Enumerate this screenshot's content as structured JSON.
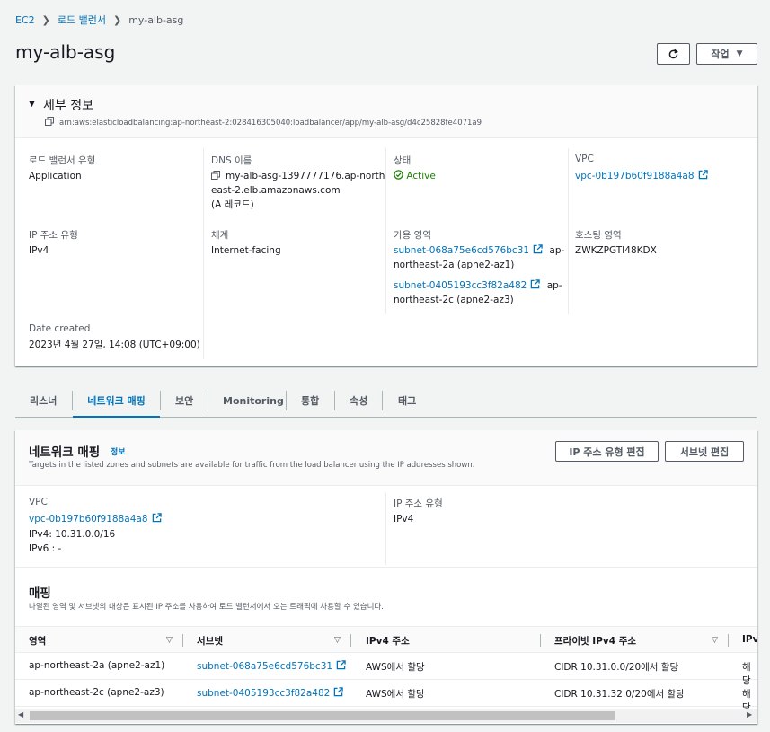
{
  "breadcrumb": {
    "items": [
      "EC2",
      "로드 밸런서",
      "my-alb-asg"
    ]
  },
  "page": {
    "title": "my-alb-asg",
    "refresh_icon": "refresh-icon",
    "actions_label": "작업"
  },
  "details": {
    "title": "세부 정보",
    "arn": "arn:aws:elasticloadbalancing:ap-northeast-2:028416305040:loadbalancer/app/my-alb-asg/d4c25828fe4071a9",
    "fields": {
      "lb_type_label": "로드 밸런서 유형",
      "lb_type_value": "Application",
      "dns_label": "DNS 이름",
      "dns_value_1": "my-alb-asg-1397777176.ap-north",
      "dns_value_2": "east-2.elb.amazonaws.com",
      "dns_value_3": "(A 레코드)",
      "state_label": "상태",
      "state_value": "Active",
      "vpc_label": "VPC",
      "vpc_value": "vpc-0b197b60f9188a4a8",
      "ip_type_label": "IP 주소 유형",
      "ip_type_value": "IPv4",
      "scheme_label": "체계",
      "scheme_value": "Internet-facing",
      "az_label": "가용 영역",
      "az1_subnet": "subnet-068a75e6cd576bc31",
      "az1_suffix_1": "ap-",
      "az1_suffix_2": "northeast-2a (apne2-az1)",
      "az2_subnet": "subnet-0405193cc3f82a482",
      "az2_suffix_1": "ap-",
      "az2_suffix_2": "northeast-2c (apne2-az3)",
      "zone_label": "호스팅 영역",
      "zone_value": "ZWKZPGTI48KDX",
      "date_label": "Date created",
      "date_value": "2023년 4월 27일, 14:08 (UTC+09:00)"
    }
  },
  "tabs": [
    "리스너",
    "네트워크 매핑",
    "보안",
    "Monitoring",
    "통합",
    "속성",
    "태그"
  ],
  "network": {
    "title": "네트워크 매핑",
    "info": "정보",
    "description": "Targets in the listed zones and subnets are available for traffic from the load balancer using the IP addresses shown.",
    "edit_ip_button": "IP 주소 유형 편집",
    "edit_subnet_button": "서브넷 편집",
    "vpc_label": "VPC",
    "vpc_value": "vpc-0b197b60f9188a4a8",
    "ipv4": "IPv4: 10.31.0.0/16",
    "ipv6": "IPv6 : -",
    "ip_type_label": "IP 주소 유형",
    "ip_type_value": "IPv4"
  },
  "mapping": {
    "title": "매핑",
    "description": "나열된 영역 및 서브넷의 대상은 표시된 IP 주소를 사용하여 로드 밸런서에서 오는 트래픽에 사용할 수 있습니다.",
    "columns": [
      "영역",
      "서브넷",
      "IPv4 주소",
      "프라이빗 IPv4 주소",
      "IPv"
    ],
    "rows": [
      {
        "zone": "ap-northeast-2a (apne2-az1)",
        "subnet": "subnet-068a75e6cd576bc31",
        "ipv4": "AWS에서 할당",
        "private": "CIDR 10.31.0.0/20에서 할당",
        "last": "해당"
      },
      {
        "zone": "ap-northeast-2c (apne2-az3)",
        "subnet": "subnet-0405193cc3f82a482",
        "ipv4": "AWS에서 할당",
        "private": "CIDR 10.31.32.0/20에서 할당",
        "last": "해당"
      }
    ]
  },
  "colors": {
    "link": "#0073bb",
    "success": "#1d8102",
    "text": "#16191f",
    "muted": "#545b64"
  }
}
